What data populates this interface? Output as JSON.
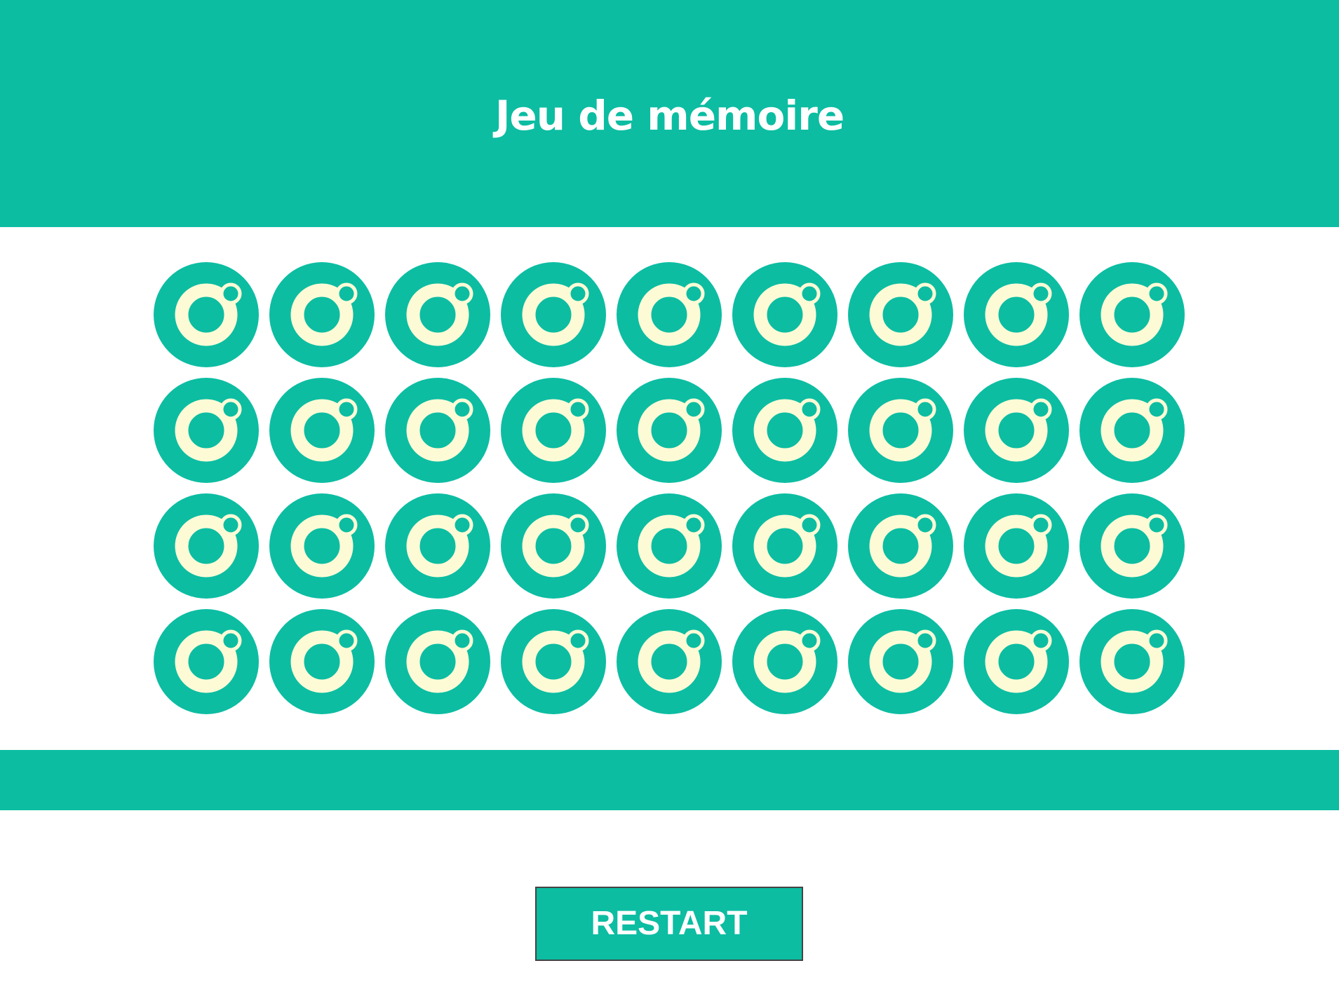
{
  "header": {
    "title": "Jeu de mémoire"
  },
  "board": {
    "rows": 4,
    "columns": 9,
    "card_state": "face-down",
    "card_back_icon": "ring-with-bubble-icon"
  },
  "controls": {
    "restart_label": "RESTART"
  },
  "colors": {
    "accent": "#0cbda2",
    "card_symbol": "#fdfbd6",
    "background": "#ffffff",
    "button_border": "#444444"
  }
}
